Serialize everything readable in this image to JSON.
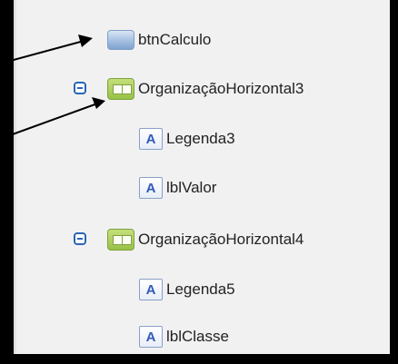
{
  "tree": {
    "items": [
      {
        "label": "btnCalculo",
        "icon": "button-icon"
      },
      {
        "label": "OrganizaçãoHorizontal3",
        "icon": "horizontal-arrangement-icon",
        "collapse_icon": "collapse-minus-icon"
      },
      {
        "label": "Legenda3",
        "icon": "label-icon",
        "icon_glyph": "A"
      },
      {
        "label": "lblValor",
        "icon": "label-icon",
        "icon_glyph": "A"
      },
      {
        "label": "OrganizaçãoHorizontal4",
        "icon": "horizontal-arrangement-icon",
        "collapse_icon": "collapse-minus-icon"
      },
      {
        "label": "Legenda5",
        "icon": "label-icon",
        "icon_glyph": "A"
      },
      {
        "label": "lblClasse",
        "icon": "label-icon",
        "icon_glyph": "A"
      }
    ]
  },
  "colors": {
    "background": "#000000",
    "panel": "#f1f1f1",
    "text": "#222222",
    "label_glyph": "#3359b8",
    "collapse_toggle": "#2a66b5",
    "annotation_arrow": "#000000"
  }
}
